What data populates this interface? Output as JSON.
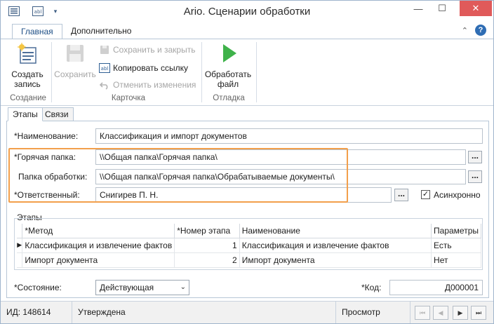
{
  "window": {
    "title": "Ario. Сценарии обработки"
  },
  "ribbon_tabs": [
    {
      "label": "Главная",
      "active": true
    },
    {
      "label": "Дополнительно",
      "active": false
    }
  ],
  "ribbon": {
    "create_label_1": "Создать",
    "create_label_2": "запись",
    "group_create": "Создание",
    "save_label": "Сохранить",
    "save_close_label": "Сохранить и закрыть",
    "copy_link_label": "Копировать ссылку",
    "undo_label": "Отменить изменения",
    "group_card": "Карточка",
    "process_label_1": "Обработать",
    "process_label_2": "файл",
    "group_debug": "Отладка"
  },
  "page_tabs": [
    {
      "label": "Этапы",
      "active": true
    },
    {
      "label": "Связи",
      "active": false
    }
  ],
  "form": {
    "name_label": "*Наименование:",
    "name_value": "Классификация и импорт документов",
    "hot_folder_label": "*Горячая папка:",
    "hot_folder_value": "\\\\Общая папка\\Горячая папка\\",
    "proc_folder_label": "Папка обработки:",
    "proc_folder_value": "\\\\Общая папка\\Горячая папка\\Обрабатываемые документы\\",
    "responsible_label": "*Ответственный:",
    "responsible_value": "Снигирев П. Н.",
    "async_label": "Асинхронно",
    "async_checked": true,
    "ellipsis": "..."
  },
  "stages": {
    "legend": "Этапы",
    "columns": [
      "*Метод",
      "*Номер этапа",
      "Наименование",
      "Параметры"
    ],
    "rows": [
      {
        "method": "Классификация и извлечение фактов",
        "number": "1",
        "name": "Классификация и извлечение фактов",
        "params": "Есть",
        "current": true
      },
      {
        "method": "Импорт документа",
        "number": "2",
        "name": "Импорт документа",
        "params": "Нет",
        "current": false
      }
    ]
  },
  "state": {
    "label": "*Состояние:",
    "value": "Действующая"
  },
  "code": {
    "label": "*Код:",
    "value": "Д000001"
  },
  "statusbar": {
    "id": "ИД: 148614",
    "status": "Утверждена",
    "mode": "Просмотр"
  },
  "colors": {
    "accent": "#2f6db4",
    "highlight": "#f29f4b",
    "play": "#3fb24a",
    "close": "#e05a5a"
  }
}
